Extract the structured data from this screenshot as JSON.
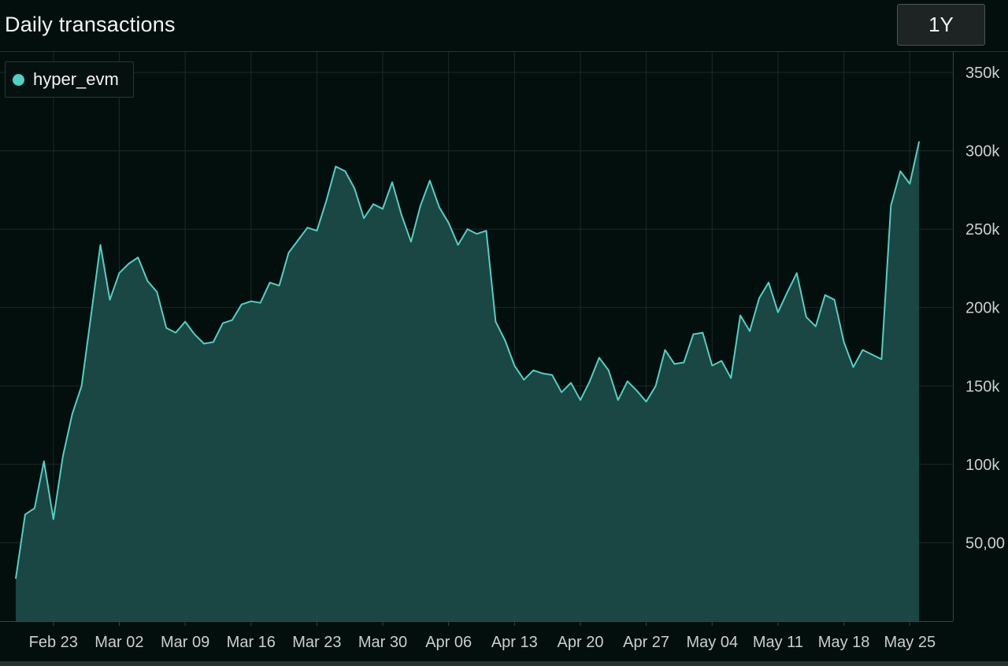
{
  "header": {
    "title": "Daily transactions",
    "range_button": "1Y"
  },
  "legend": {
    "series_name": "hyper_evm"
  },
  "colors": {
    "line": "#4fd1c5",
    "area": "#1b4a47",
    "grid": "#1f2927",
    "background": "#030f0d"
  },
  "chart_data": {
    "type": "area",
    "title": "Daily transactions",
    "xlabel": "",
    "ylabel": "",
    "ylim": [
      0,
      350000
    ],
    "grid": true,
    "legend_position": "top-left",
    "y_ticks": [
      {
        "value": 350000,
        "label": "350k"
      },
      {
        "value": 300000,
        "label": "300k"
      },
      {
        "value": 250000,
        "label": "250k"
      },
      {
        "value": 200000,
        "label": "200k"
      },
      {
        "value": 150000,
        "label": "150k"
      },
      {
        "value": 100000,
        "label": "100k"
      },
      {
        "value": 50000,
        "label": "50,00"
      }
    ],
    "x_ticks": [
      "Feb 23",
      "Mar 02",
      "Mar 09",
      "Mar 16",
      "Mar 23",
      "Mar 30",
      "Apr 06",
      "Apr 13",
      "Apr 20",
      "Apr 27",
      "May 04",
      "May 11",
      "May 18",
      "May 25"
    ],
    "x_start": "Feb 19",
    "series": [
      {
        "name": "hyper_evm",
        "values": [
          27000,
          68000,
          72000,
          102000,
          65000,
          105000,
          132000,
          150000,
          195000,
          240000,
          205000,
          222000,
          228000,
          232000,
          217000,
          210000,
          187000,
          184000,
          191000,
          183000,
          177000,
          178000,
          190000,
          192000,
          202000,
          204000,
          203000,
          216000,
          214000,
          235000,
          243000,
          251000,
          249000,
          268000,
          290000,
          287000,
          276000,
          257000,
          266000,
          263000,
          280000,
          259000,
          242000,
          265000,
          281000,
          264000,
          254000,
          240000,
          250000,
          247000,
          249000,
          191000,
          179000,
          163000,
          154000,
          160000,
          158000,
          157000,
          146000,
          152000,
          141000,
          153000,
          168000,
          160000,
          141000,
          153000,
          147000,
          140000,
          150000,
          173000,
          164000,
          165000,
          183000,
          184000,
          163000,
          166000,
          155000,
          195000,
          185000,
          206000,
          216000,
          197000,
          210000,
          222000,
          194000,
          188000,
          208000,
          205000,
          178000,
          162000,
          173000,
          170000,
          167000,
          265000,
          287000,
          279000,
          306000
        ]
      }
    ]
  }
}
